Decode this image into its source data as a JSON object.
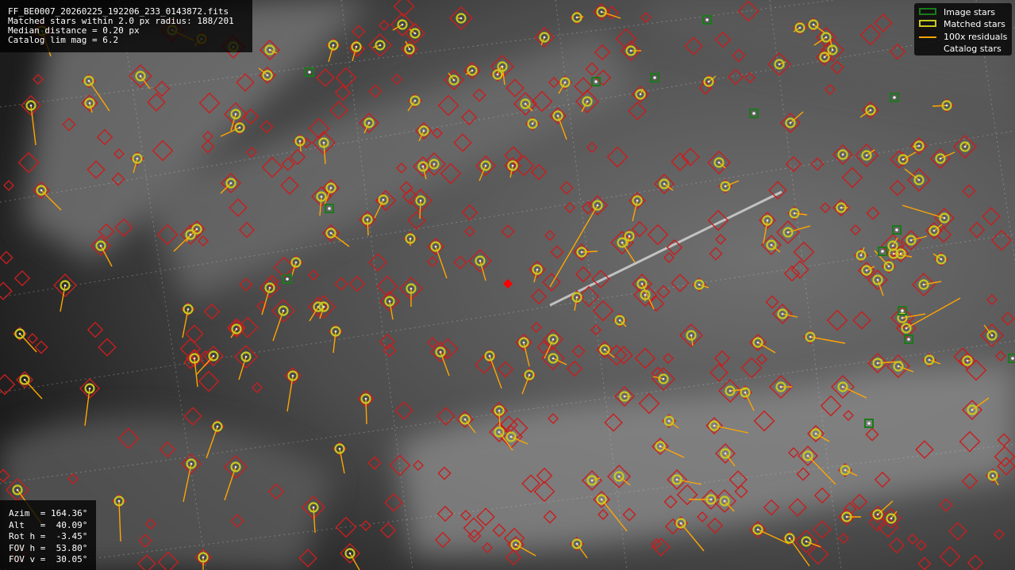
{
  "header": {
    "filename": "FF_BE0007_20260225_192206_233_0143872.fits",
    "matched_line": "Matched stars within 2.0 px radius: 188/201",
    "median_line": "Median distance = 0.20 px",
    "catalog_line": "Catalog lim mag = 6.2"
  },
  "pointing": {
    "azim": "Azim  = 164.36°",
    "alt": "Alt   =  40.09°",
    "rot": "Rot h =  -3.45°",
    "fov_h": "FOV h =  53.80°",
    "fov_v": "FOV v =  30.05°"
  },
  "legend": {
    "image_stars": "Image stars",
    "matched_stars": "Matched stars",
    "residuals": "100x residuals",
    "catalog_stars": "Catalog stars"
  },
  "colors": {
    "image_star": "#1a7a1a",
    "matched_star": "#c8c820",
    "residual": "#ffa500",
    "catalog_star": "#c81e1e",
    "center_marker": "#ff0000"
  }
}
